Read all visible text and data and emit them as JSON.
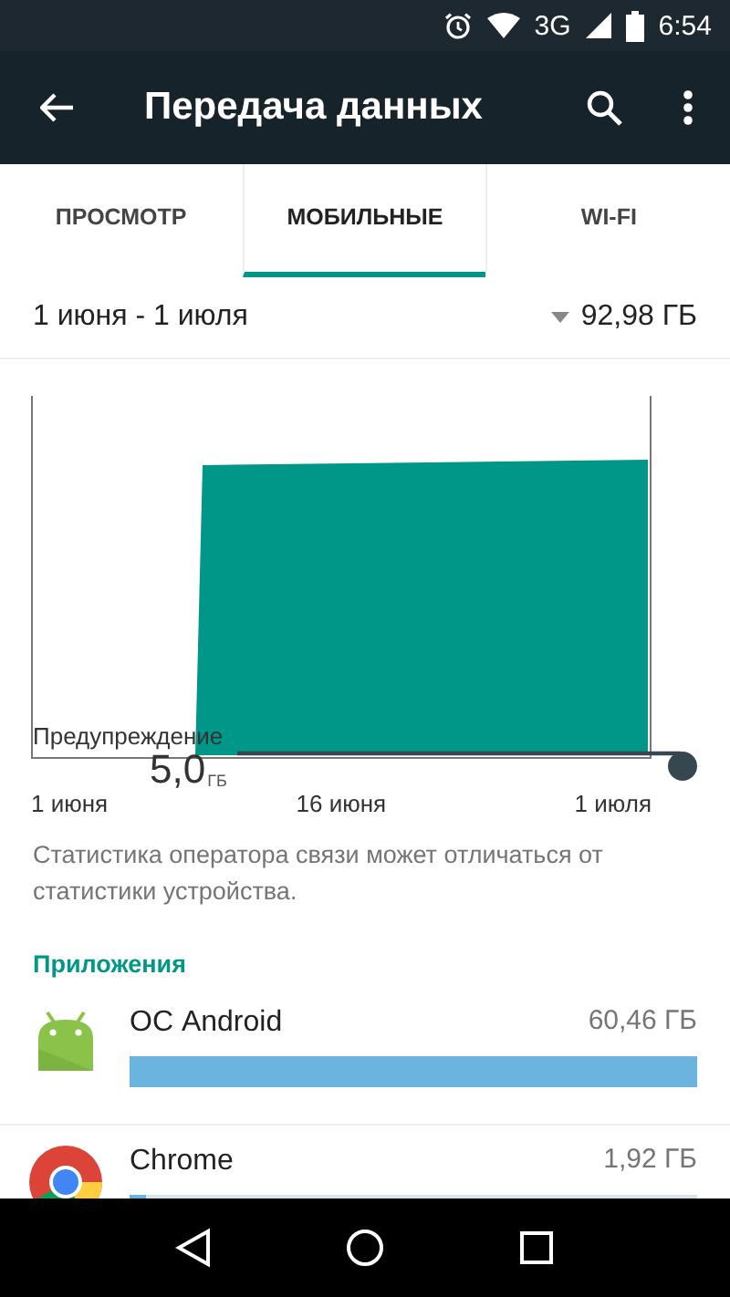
{
  "status_bar": {
    "network": "3G",
    "time": "6:54"
  },
  "toolbar": {
    "title": "Передача данных"
  },
  "tabs": [
    {
      "label": "ПРОСМОТР",
      "selected": false
    },
    {
      "label": "МОБИЛЬНЫЕ",
      "selected": true
    },
    {
      "label": "WI-FI",
      "selected": false
    }
  ],
  "cycle": {
    "period": "1 июня - 1 июля",
    "total": "92,98 ГБ"
  },
  "chart": {
    "warning_label": "Предупреждение",
    "warning_value": "5,0",
    "warning_unit": "ГБ",
    "x_labels": [
      "1 июня",
      "16 июня",
      "1 июля"
    ]
  },
  "note": "Статистика оператора связи может отличаться от статистики устройства.",
  "section_title": "Приложения",
  "apps": [
    {
      "kind": "android",
      "name": "ОС Android",
      "usage": "60,46 ГБ",
      "level": 1.0
    },
    {
      "kind": "chrome",
      "name": "Chrome",
      "usage": "1,92 ГБ",
      "level": 0.03
    }
  ]
}
